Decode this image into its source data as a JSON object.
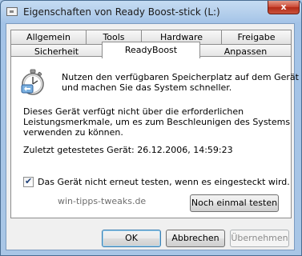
{
  "window": {
    "title": "Eigenschaften von Ready Boost-stick (L:)",
    "close_glyph": "x"
  },
  "tabs_row1": [
    "Allgemein",
    "Tools",
    "Hardware",
    "Freigabe"
  ],
  "tabs_row2": [
    "Sicherheit",
    "ReadyBoost",
    "Anpassen"
  ],
  "active_tab": "ReadyBoost",
  "panel": {
    "intro_line1": "Nutzen den verfügbaren Speicherplatz auf dem Gerät",
    "intro_line2": "und machen Sie das System schneller.",
    "warn_line1": "Dieses Gerät verfügt nicht über die erforderlichen",
    "warn_line2": "Leistungsmerkmale, um es zum Beschleunigen des Systems",
    "warn_line3": "verwenden zu können.",
    "last_tested": "Zuletzt getestetes Gerät: 26.12.2006, 14:59:23",
    "checkbox_label": "Das Gerät nicht erneut testen, wenn es eingesteckt wird.",
    "checkbox_checked": true,
    "retest_button": "Noch einmal testen"
  },
  "watermark": "win-tipps-tweaks.de",
  "buttons": {
    "ok": "OK",
    "cancel": "Abbrechen",
    "apply": "Übernehmen"
  },
  "icons": {
    "readyboost": "readyboost-stopwatch-icon",
    "window": "drive-icon"
  }
}
